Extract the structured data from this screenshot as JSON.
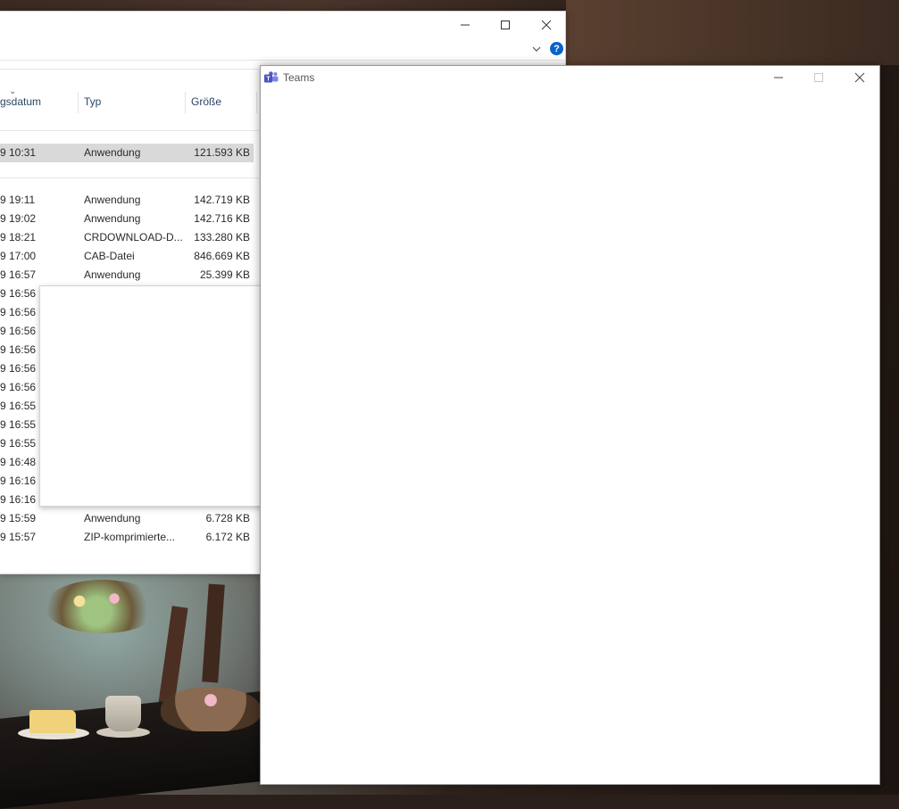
{
  "explorer": {
    "controls": {
      "minimize": "—",
      "maximize": "☐",
      "close": "✕"
    },
    "ribbon": {
      "expand_icon": "chevron-down",
      "help_label": "?"
    },
    "columns": {
      "date": "gsdatum",
      "type": "Typ",
      "size": "Größe"
    },
    "selected_row": {
      "date": "9 10:31",
      "type": "Anwendung",
      "size": "121.593 KB"
    },
    "rows": [
      {
        "date": "9 19:11",
        "type": "Anwendung",
        "size": "142.719 KB"
      },
      {
        "date": "9 19:02",
        "type": "Anwendung",
        "size": "142.716 KB"
      },
      {
        "date": "9 18:21",
        "type": "CRDOWNLOAD-D...",
        "size": "133.280 KB"
      },
      {
        "date": "9 17:00",
        "type": "CAB-Datei",
        "size": "846.669 KB"
      },
      {
        "date": "9 16:57",
        "type": "Anwendung",
        "size": "25.399 KB"
      }
    ],
    "hidden_dates": [
      "9 16:56",
      "9 16:56",
      "9 16:56",
      "9 16:56",
      "9 16:56",
      "9 16:56",
      "9 16:55",
      "9 16:55",
      "9 16:55",
      "9 16:48",
      "9 16:16",
      "9 16:16"
    ],
    "bottom_rows": [
      {
        "date": "9 15:59",
        "type": "Anwendung",
        "size": "6.728 KB"
      },
      {
        "date": "9 15:57",
        "type": "ZIP-komprimierte...",
        "size": "6.172 KB"
      }
    ]
  },
  "teams": {
    "title": "Teams",
    "controls": {
      "minimize": "—",
      "maximize": "☐",
      "close": "✕"
    },
    "accent": "#5b5fc7"
  }
}
